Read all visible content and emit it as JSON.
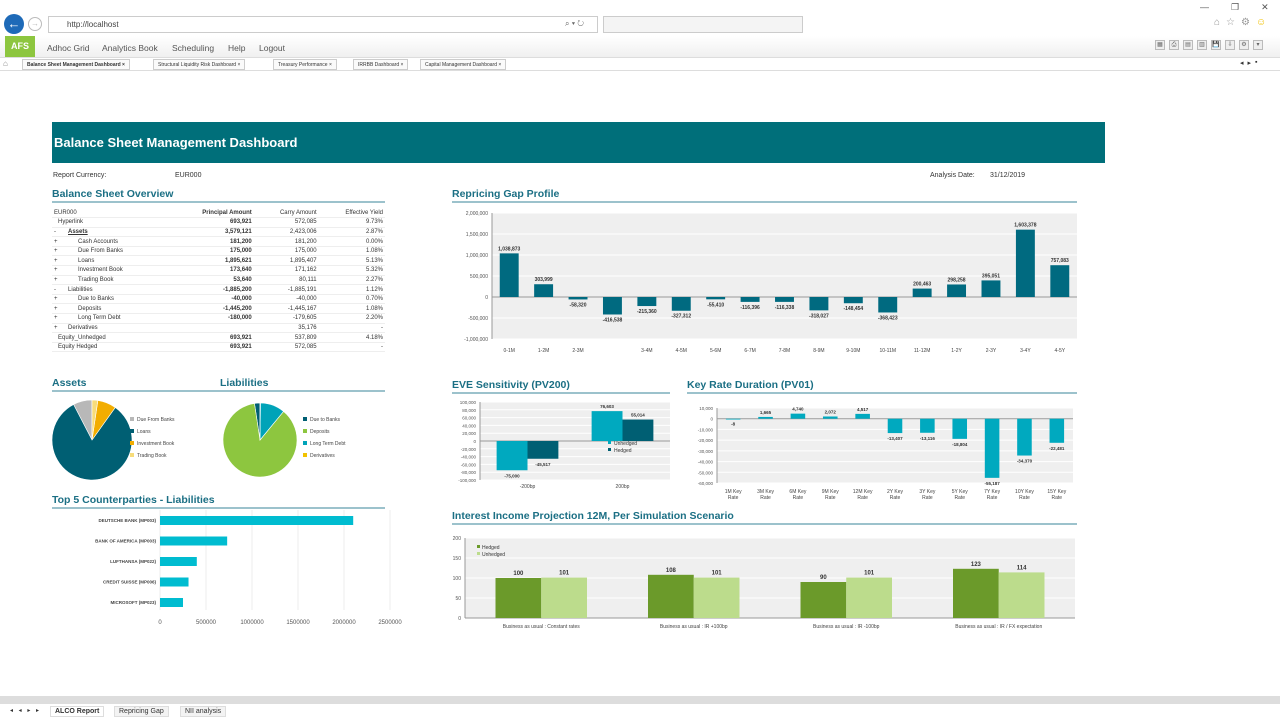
{
  "browser": {
    "url": "http://localhost",
    "tab_title": "",
    "back": "←",
    "fwd": "→",
    "search_refresh": "⌕ ▾ ↻",
    "window_controls": [
      "—",
      "❐",
      "✕"
    ],
    "right_icons": [
      "⌂",
      "☆",
      "⚙",
      "☺"
    ]
  },
  "app": {
    "logo": "AFS",
    "menu": [
      "Adhoc Grid",
      "Analytics Book",
      "Scheduling",
      "Help",
      "Logout"
    ],
    "tabs": [
      "Balance Sheet Management Dashboard ×",
      "Structural Liquidity Risk Dashboard ×",
      "Treasury Performance ×",
      "IRRBB Dashboard ×",
      "Capital Management Dashboard ×"
    ],
    "toolbar": [
      "▦",
      "⎙",
      "▤",
      "▥",
      "💾",
      "⇩",
      "⚙",
      "▾"
    ],
    "nav": [
      "◂",
      "▸",
      "▪"
    ]
  },
  "dashboard": {
    "title": "Balance Sheet Management Dashboard",
    "currency_label": "Report Currency:",
    "currency_value": "EUR000",
    "date_label": "Analysis Date:",
    "date_value": "31/12/2019"
  },
  "overview": {
    "title": "Balance Sheet Overview",
    "headers": [
      "EUR000",
      "Principal Amount",
      "Carry Amount",
      "Effective Yield"
    ],
    "rows": [
      {
        "pre": "",
        "label": "Hyperlink",
        "lvl": 0,
        "b": false,
        "v": [
          "693,921",
          "572,085",
          "9.73%"
        ]
      },
      {
        "pre": "-",
        "label": "Assets",
        "lvl": 1,
        "b": true,
        "v": [
          "3,579,121",
          "2,423,006",
          "2.87%"
        ]
      },
      {
        "pre": "+",
        "label": "Cash Accounts",
        "lvl": 2,
        "b": false,
        "v": [
          "181,200",
          "181,200",
          "0.00%"
        ]
      },
      {
        "pre": "+",
        "label": "Due From Banks",
        "lvl": 2,
        "b": false,
        "v": [
          "175,000",
          "175,000",
          "1.08%"
        ]
      },
      {
        "pre": "+",
        "label": "Loans",
        "lvl": 2,
        "b": false,
        "v": [
          "1,895,621",
          "1,895,407",
          "5.13%"
        ]
      },
      {
        "pre": "+",
        "label": "Investment Book",
        "lvl": 2,
        "b": false,
        "v": [
          "173,640",
          "171,162",
          "5.32%"
        ]
      },
      {
        "pre": "+",
        "label": "Trading Book",
        "lvl": 2,
        "b": false,
        "v": [
          "53,640",
          "80,111",
          "2.27%"
        ]
      },
      {
        "pre": "-",
        "label": "Liabilities",
        "lvl": 1,
        "b": false,
        "v": [
          "-1,885,200",
          "-1,885,191",
          "1.12%"
        ]
      },
      {
        "pre": "+",
        "label": "Due to Banks",
        "lvl": 2,
        "b": false,
        "v": [
          "-40,000",
          "-40,000",
          "0.70%"
        ]
      },
      {
        "pre": "+",
        "label": "Deposits",
        "lvl": 2,
        "b": false,
        "v": [
          "-1,445,200",
          "-1,445,167",
          "1.08%"
        ]
      },
      {
        "pre": "+",
        "label": "Long Term Debt",
        "lvl": 2,
        "b": false,
        "v": [
          "-180,000",
          "-179,605",
          "2.20%"
        ]
      },
      {
        "pre": "+",
        "label": "Derivatives",
        "lvl": 1,
        "b": false,
        "v": [
          "",
          "35,176",
          "-"
        ]
      },
      {
        "pre": "",
        "label": "Equity_Unhedged",
        "lvl": 0,
        "b": false,
        "v": [
          "693,921",
          "537,809",
          "4.18%"
        ]
      },
      {
        "pre": "",
        "label": "Equity Hedged",
        "lvl": 0,
        "b": false,
        "v": [
          "693,921",
          "572,085",
          "-"
        ]
      }
    ]
  },
  "sheets": [
    "ALCO Report",
    "Repricing Gap",
    "NII analysis"
  ],
  "sheet_nav": "◂ ◂ ▸ ▸",
  "chart_data": [
    {
      "id": "repricing",
      "type": "bar",
      "title": "Repricing Gap Profile",
      "categories": [
        "0-1M",
        "1-2M",
        "2-3M",
        "",
        "3-4M",
        "4-5M",
        "5-6M",
        "6-7M",
        "7-8M",
        "8-9M",
        "9-10M",
        "10-11M",
        "11-12M",
        "1-2Y",
        "2-3Y",
        "3-4Y",
        "4-5Y"
      ],
      "values": [
        1038873,
        303999,
        -58320,
        -416538,
        -215360,
        -327312,
        -55410,
        -116396,
        -116338,
        -318027,
        -148454,
        -368423,
        200463,
        298258,
        395051,
        1603378,
        757083
      ],
      "labels": [
        "1,038,873",
        "303,999",
        "-58,320",
        "-416,538",
        "-215,360",
        "-327,312",
        "-55,410",
        "-116,396",
        "-116,338",
        "-318,027",
        "-148,454",
        "-368,423",
        "200,463",
        "298,258",
        "395,051",
        "1,603,378",
        "757,083"
      ],
      "ylim": [
        -1000000,
        2000000
      ],
      "yticks": [
        "2,000,000",
        "1,500,000",
        "1,000,000",
        "500,000",
        "0",
        "-500,000",
        "-1,000,000"
      ],
      "color": "#006a80"
    },
    {
      "id": "eve",
      "type": "bar",
      "title": "EVE Sensitivity (PV200)",
      "categories": [
        "-200bp",
        "200bp"
      ],
      "series": [
        {
          "name": "Unhedged",
          "values": [
            -75000,
            76603
          ],
          "labels": [
            "-75,000",
            "76,603"
          ],
          "color": "#00a9bf"
        },
        {
          "name": "Hedged",
          "values": [
            -45517,
            55014
          ],
          "labels": [
            "-45,517",
            "55,014"
          ],
          "color": "#005f73"
        }
      ],
      "ylim": [
        -100000,
        100000
      ],
      "yticks": [
        "100,000",
        "80,000",
        "60,000",
        "40,000",
        "20,000",
        "0",
        "-20,000",
        "-40,000",
        "-60,000",
        "-80,000",
        "-100,000"
      ],
      "legend": "right"
    },
    {
      "id": "krd",
      "type": "bar",
      "title": "Key Rate Duration (PV01)",
      "categories": [
        "1M Key Rate",
        "3M Key Rate",
        "6M Key Rate",
        "9M Key Rate",
        "12M Key Rate",
        "2Y Key Rate",
        "3Y Key Rate",
        "5Y Key Rate",
        "7Y Key Rate",
        "10Y Key Rate",
        "15Y Key Rate"
      ],
      "values": [
        -8,
        1665,
        4740,
        2072,
        4517,
        -13407,
        -13116,
        -18804,
        -55187,
        -34370,
        -22481
      ],
      "labels": [
        "-8",
        "1,665",
        "4,740",
        "2,072",
        "4,517",
        "-13,407",
        "-13,116",
        "-18,804",
        "-55,187",
        "-34,370",
        "-22,481"
      ],
      "ylim": [
        -60000,
        10000
      ],
      "yticks": [
        "10,000",
        "0",
        "-10,000",
        "-20,000",
        "-30,000",
        "-40,000",
        "-50,000",
        "-60,000"
      ],
      "color": "#00a9bf"
    },
    {
      "id": "nii",
      "type": "bar",
      "title": "Interest Income Projection 12M, Per Simulation Scenario",
      "categories": [
        "Business as usual : Constant rates",
        "Business as usual : IR +100bp",
        "Business as usual : IR -100bp",
        "Business as usual : IR / FX expectation"
      ],
      "series": [
        {
          "name": "Hedged",
          "values": [
            100,
            108,
            90,
            123
          ],
          "color": "#6b9a2a"
        },
        {
          "name": "Unhedged",
          "values": [
            101,
            101,
            101,
            114
          ],
          "color": "#bcdc8c"
        }
      ],
      "ylim": [
        0,
        200
      ],
      "yticks": [
        "200",
        "150",
        "100",
        "50",
        "0"
      ],
      "legend": "top-left"
    },
    {
      "id": "assets",
      "type": "pie",
      "title": "Assets",
      "labels": [
        "Due From Banks",
        "Loans",
        "Investment Book",
        "Trading Book"
      ],
      "values": [
        175000,
        1895621,
        173640,
        53640
      ],
      "colors": [
        "#b8b8b8",
        "#005f73",
        "#f2ad00",
        "#f7dc7a"
      ]
    },
    {
      "id": "liabs",
      "type": "pie",
      "title": "Liabilities",
      "labels": [
        "Due to Banks",
        "Deposits",
        "Long Term Debt",
        "Derivatives"
      ],
      "values": [
        40000,
        1445200,
        180000,
        3000
      ],
      "colors": [
        "#005f73",
        "#8dc63f",
        "#00a3b8",
        "#f2c200"
      ]
    },
    {
      "id": "cpty",
      "type": "bar-horizontal",
      "title": "Top 5 Counterparties - Liabilities",
      "categories": [
        "DEUTSCHE BANK (MP003)",
        "BANK OF AMERICA (MP003)",
        "LUFTHANSA (MP022)",
        "CREDIT SUISSE (MP006)",
        "MICROSOFT (MP023)"
      ],
      "values": [
        2100000,
        730000,
        400000,
        310000,
        250000
      ],
      "xlim": [
        0,
        2500000
      ],
      "xticks": [
        "0",
        "500000",
        "1000000",
        "1500000",
        "2000000",
        "2500000"
      ],
      "color": "#00bcd0"
    }
  ]
}
